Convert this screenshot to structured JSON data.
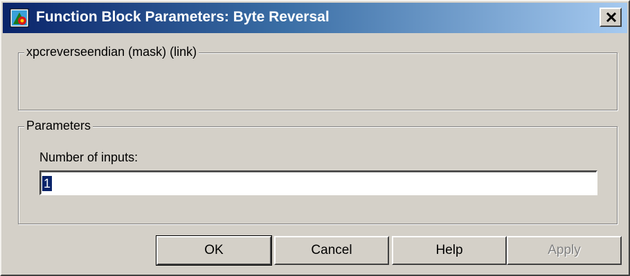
{
  "window": {
    "title": "Function Block Parameters: Byte Reversal",
    "icon": "simulink-block-icon",
    "close_glyph": "close-icon"
  },
  "mask_group": {
    "legend": "xpcreverseendian (mask) (link)"
  },
  "parameters_group": {
    "legend": "Parameters",
    "number_of_inputs": {
      "label": "Number of inputs:",
      "value": "1"
    }
  },
  "buttons": {
    "ok": "OK",
    "cancel": "Cancel",
    "help": "Help",
    "apply": "Apply"
  },
  "colors": {
    "title_start": "#0a246a",
    "title_end": "#a6caf0",
    "dialog_bg": "#d4d0c8"
  }
}
